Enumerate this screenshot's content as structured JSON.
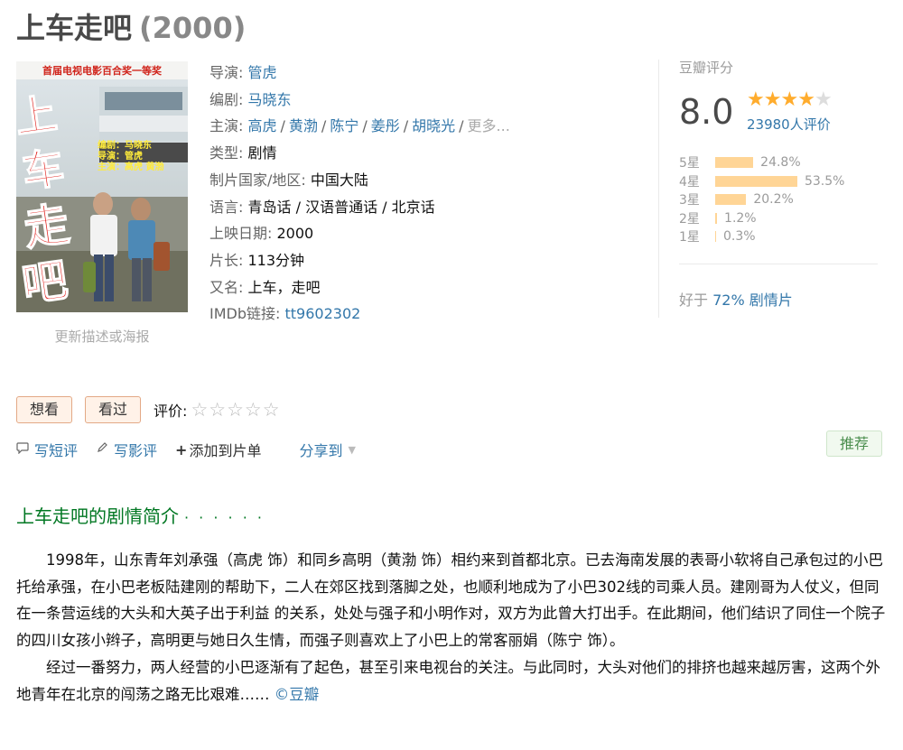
{
  "title": {
    "name": "上车走吧",
    "year": "(2000)"
  },
  "poster": {
    "update_link": "更新描述或海报",
    "top_text": "首届电视电影百合奖一等奖",
    "big_text": [
      "上",
      "车",
      "走",
      "吧"
    ],
    "credits": [
      "编剧：马晓东",
      "导演：管虎",
      "主演：高虎    黄渤"
    ]
  },
  "info": {
    "director_label": "导演:",
    "director": "管虎",
    "writer_label": "编剧:",
    "writer": "马晓东",
    "cast_label": "主演:",
    "cast": [
      "高虎",
      "黄渤",
      "陈宁",
      "姜彤",
      "胡晓光"
    ],
    "cast_more": "更多...",
    "sep": "/",
    "genre_label": "类型:",
    "genre": "剧情",
    "country_label": "制片国家/地区:",
    "country": "中国大陆",
    "language_label": "语言:",
    "language": "青岛话 / 汉语普通话 / 北京话",
    "release_label": "上映日期:",
    "release": "2000",
    "runtime_label": "片长:",
    "runtime": "113分钟",
    "aka_label": "又名:",
    "aka": "上车，走吧",
    "imdb_label": "IMDb链接:",
    "imdb": "tt9602302"
  },
  "rating": {
    "label": "豆瓣评分",
    "score": "8.0",
    "stars": 4,
    "count": "23980人评价",
    "distribution": [
      {
        "label": "5星",
        "percent": "24.8%",
        "value": 24.8
      },
      {
        "label": "4星",
        "percent": "53.5%",
        "value": 53.5
      },
      {
        "label": "3星",
        "percent": "20.2%",
        "value": 20.2
      },
      {
        "label": "2星",
        "percent": "1.2%",
        "value": 1.2
      },
      {
        "label": "1星",
        "percent": "0.3%",
        "value": 0.3
      }
    ],
    "better_prefix": "好于",
    "better_link": "72% 剧情片",
    "star_color": "#ffac2d",
    "bar_color": "#ffd596"
  },
  "actions": {
    "want": "想看",
    "seen": "看过",
    "rate_label": "评价:",
    "rate_stars": "☆☆☆☆☆"
  },
  "links": {
    "short_review": "写短评",
    "review": "写影评",
    "add_list": "添加到片单",
    "share": "分享到",
    "recommend": "推荐"
  },
  "summary": {
    "heading": "上车走吧的剧情简介",
    "heading_dots": "· · · · · ·",
    "p1": "1998年，山东青年刘承强（高虎 饰）和同乡高明（黄渤 饰）相约来到首都北京。已去海南发展的表哥小软将自己承包过的小巴托给承强，在小巴老板陆建刚的帮助下，二人在郊区找到落脚之处，也顺利地成为了小巴302线的司乘人员。建刚哥为人仗义，但同在一条营运线的大头和大英子出于利益 的关系，处处与强子和小明作对，双方为此曾大打出手。在此期间，他们结识了同住一个院子的四川女孩小辫子，高明更与她日久生情，而强子则喜欢上了小巴上的常客丽娟（陈宁 饰）。",
    "p2": "经过一番努力，两人经营的小巴逐渐有了起色，甚至引来电视台的关注。与此同时，大头对他们的排挤也越来越厉害，这两个外地青年在北京的闯荡之路无比艰难……",
    "source": "©豆瓣"
  }
}
